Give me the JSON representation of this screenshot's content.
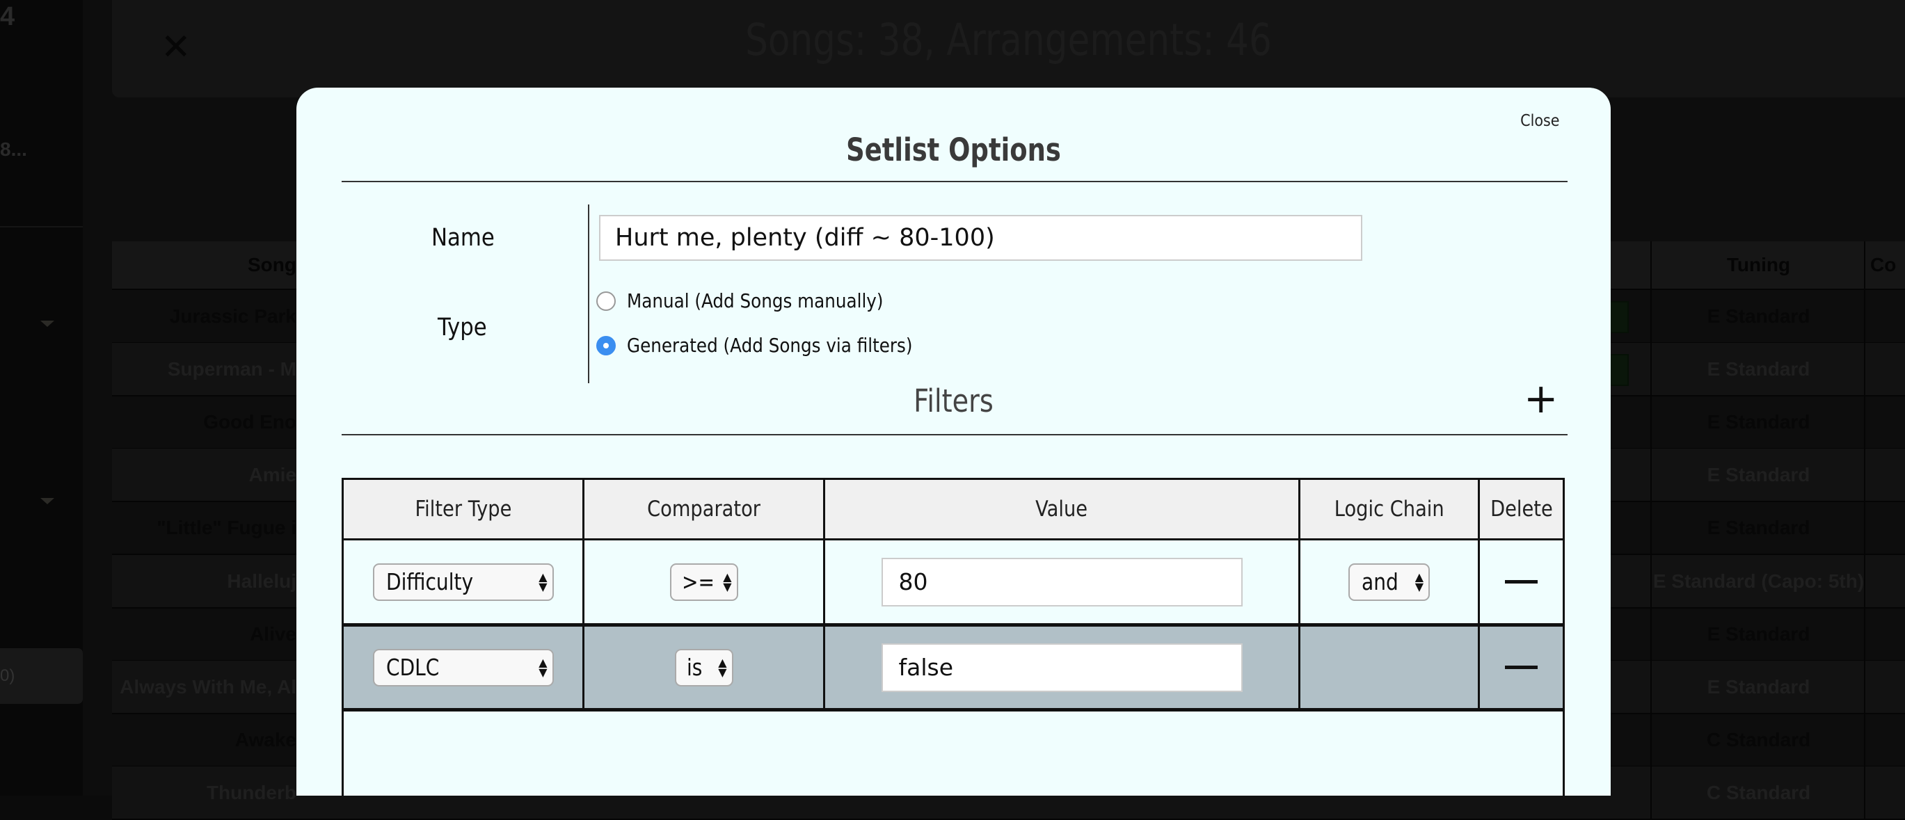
{
  "background": {
    "sidebar": {
      "top_text": "4",
      "item_text": "8...",
      "active_item_text": "0)"
    },
    "header": {
      "close_icon": "close-icon",
      "title": "Songs: 38, Arrangements: 46"
    },
    "table": {
      "headers": {
        "song": "Song",
        "tuning": "Tuning",
        "count": "Co"
      },
      "rows": [
        {
          "song": "Jurassic Park",
          "tuning": "E Standard"
        },
        {
          "song": "Superman - M",
          "tuning": "E Standard"
        },
        {
          "song": "Good Eno",
          "tuning": "E Standard"
        },
        {
          "song": "Amie",
          "tuning": "E Standard"
        },
        {
          "song": "\"Little\" Fugue i",
          "tuning": "E Standard"
        },
        {
          "song": "Halleluj",
          "tuning": "E Standard (Capo: 5th)"
        },
        {
          "song": "Alive",
          "tuning": "E Standard"
        },
        {
          "song": "Always With Me, Al",
          "tuning": "E Standard"
        },
        {
          "song": "Awake",
          "tuning": "C Standard"
        },
        {
          "song": "Thunderb",
          "tuning": "C Standard"
        }
      ]
    }
  },
  "modal": {
    "title": "Setlist Options",
    "close_label": "Close",
    "name_label": "Name",
    "name_value": "Hurt me, plenty (diff ~ 80-100)",
    "type_label": "Type",
    "type_options": [
      {
        "label": "Manual (Add Songs manually)",
        "selected": false
      },
      {
        "label": "Generated (Add Songs via filters)",
        "selected": true
      }
    ],
    "accent_color": "#3b8ef0",
    "filters_heading": "Filters",
    "add_filter_icon": "plus-icon",
    "filter_table": {
      "headers": [
        "Filter Type",
        "Comparator",
        "Value",
        "Logic Chain",
        "Delete"
      ],
      "rows": [
        {
          "filter_type": "Difficulty",
          "comparator": ">=",
          "value": "80",
          "logic_chain": "and"
        },
        {
          "filter_type": "CDLC",
          "comparator": "is",
          "value": "false",
          "logic_chain": ""
        }
      ]
    }
  }
}
